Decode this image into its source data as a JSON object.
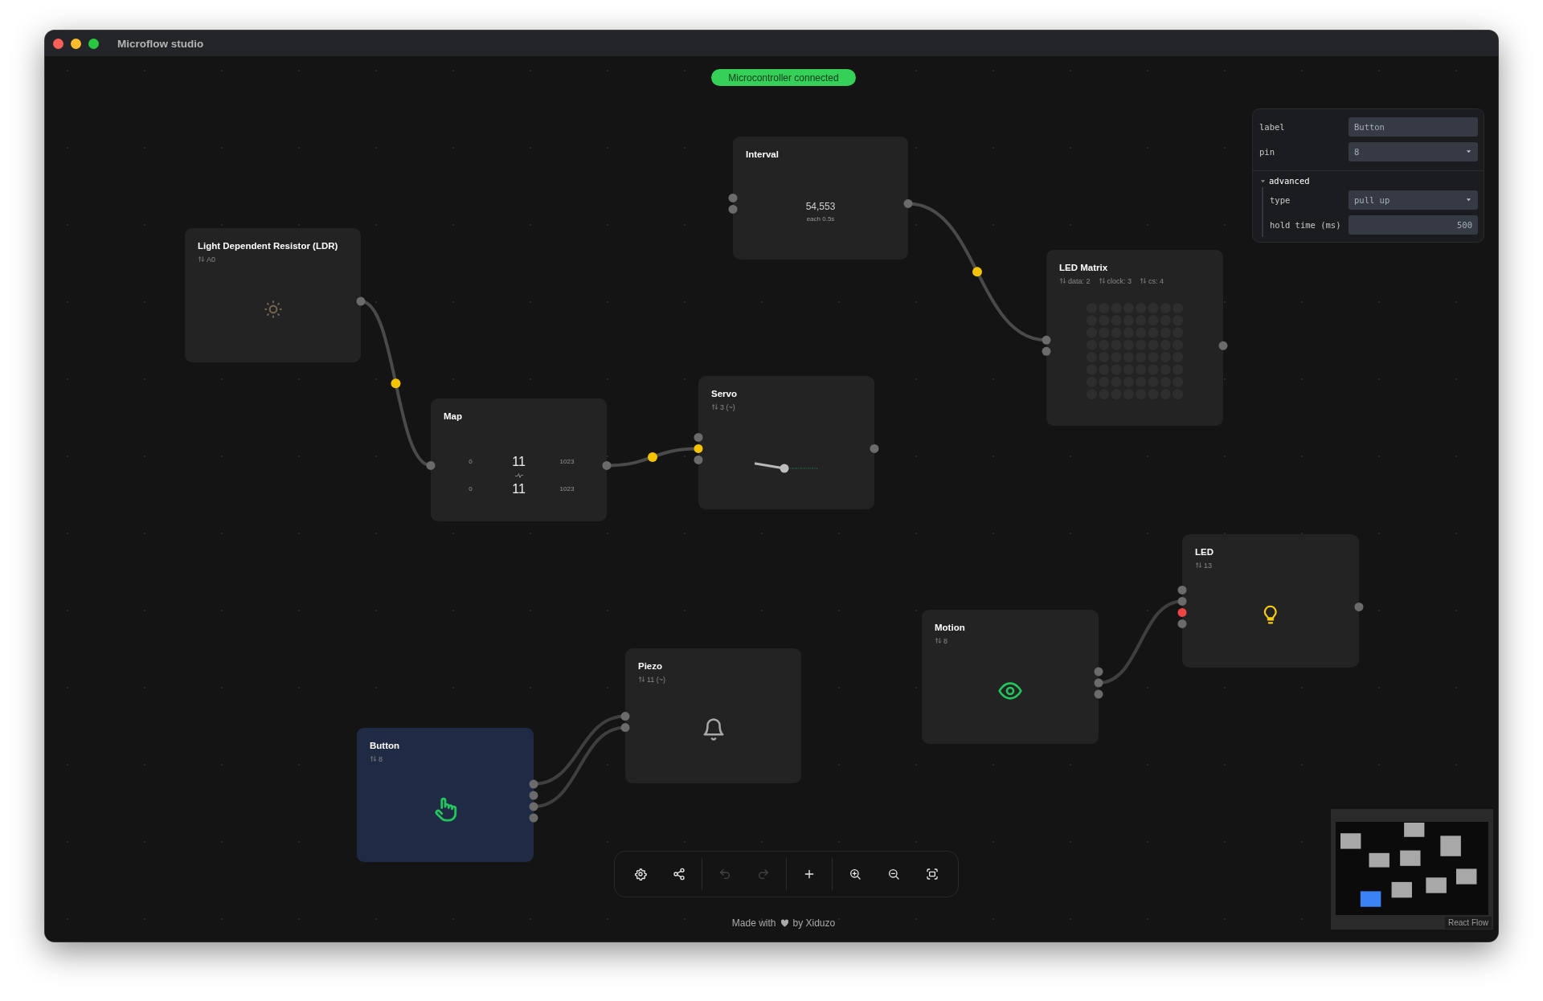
{
  "window": {
    "title": "Microflow studio"
  },
  "status_badge": {
    "text": "Microcontroller connected",
    "connected": true
  },
  "nodes": [
    {
      "kind": "ldr",
      "title": "Light Dependent Resistor (LDR)",
      "pins": [
        "A0"
      ],
      "selected": false,
      "outputs": [
        {
          "color": "#6b6b6b"
        }
      ]
    },
    {
      "kind": "interval",
      "title": "Interval",
      "value": "54,553",
      "caption": "each 0.5s",
      "selected": false,
      "inputs": [
        {
          "color": "#6b6b6b"
        },
        {
          "color": "#6b6b6b"
        }
      ],
      "outputs": [
        {
          "color": "#6b6b6b"
        }
      ]
    },
    {
      "kind": "matrix",
      "title": "LED Matrix",
      "pins": [
        "data: 2",
        "clock: 3",
        "cs: 4"
      ],
      "selected": false,
      "inputs": [
        {
          "color": "#6b6b6b"
        },
        {
          "color": "#6b6b6b"
        }
      ],
      "outputs": [
        {
          "color": "#6b6b6b"
        }
      ]
    },
    {
      "kind": "map",
      "title": "Map",
      "rows": [
        [
          "0",
          "11",
          "1023"
        ],
        [
          "0",
          "11",
          "1023"
        ]
      ],
      "selected": false,
      "inputs": [
        {
          "color": "#6b6b6b"
        }
      ],
      "outputs": [
        {
          "color": "#6b6b6b"
        }
      ]
    },
    {
      "kind": "servo",
      "title": "Servo",
      "pins": [
        "3 (~)"
      ],
      "selected": false,
      "inputs": [
        {
          "color": "#6b6b6b"
        },
        {
          "color": "#f5c400"
        },
        {
          "color": "#6b6b6b"
        }
      ],
      "outputs": [
        {
          "color": "#6b6b6b"
        }
      ]
    },
    {
      "kind": "led",
      "title": "LED",
      "pins": [
        "13"
      ],
      "on": true,
      "selected": false,
      "inputs": [
        {
          "color": "#6b6b6b"
        },
        {
          "color": "#6b6b6b"
        },
        {
          "color": "#ef4444"
        },
        {
          "color": "#6b6b6b"
        }
      ],
      "outputs": [
        {
          "color": "#6b6b6b"
        }
      ]
    },
    {
      "kind": "motion",
      "title": "Motion",
      "pins": [
        "8"
      ],
      "selected": false,
      "outputs": [
        {
          "color": "#6b6b6b"
        },
        {
          "color": "#6b6b6b"
        },
        {
          "color": "#6b6b6b"
        }
      ]
    },
    {
      "kind": "piezo",
      "title": "Piezo",
      "pins": [
        "11 (~)"
      ],
      "selected": false,
      "inputs": [
        {
          "color": "#6b6b6b"
        },
        {
          "color": "#6b6b6b"
        }
      ]
    },
    {
      "kind": "button",
      "title": "Button",
      "pins": [
        "8"
      ],
      "selected": true,
      "outputs": [
        {
          "color": "#6b6b6b"
        },
        {
          "color": "#6b6b6b"
        },
        {
          "color": "#6b6b6b"
        },
        {
          "color": "#6b6b6b"
        }
      ]
    }
  ],
  "edges": [
    {
      "active": true
    },
    {
      "active": true
    },
    {
      "active": true
    },
    {
      "active": false
    },
    {
      "active": false
    },
    {
      "active": false
    }
  ],
  "inspector": {
    "fields": [
      {
        "label": "label",
        "kind": "text",
        "value": "Button"
      },
      {
        "label": "pin",
        "kind": "select",
        "value": "8"
      }
    ],
    "section": {
      "title": "advanced",
      "expanded": true,
      "fields": [
        {
          "label": "type",
          "kind": "select",
          "value": "pull up"
        },
        {
          "label": "hold time (ms)",
          "kind": "number",
          "value": "500"
        }
      ]
    }
  },
  "toolbar": [
    {
      "kind": "settings",
      "disabled": false
    },
    {
      "kind": "share",
      "disabled": false
    },
    {
      "kind": "divider"
    },
    {
      "kind": "undo",
      "disabled": true
    },
    {
      "kind": "redo",
      "disabled": true
    },
    {
      "kind": "divider"
    },
    {
      "kind": "add",
      "disabled": false
    },
    {
      "kind": "divider"
    },
    {
      "kind": "zoom_in",
      "disabled": false
    },
    {
      "kind": "zoom_out",
      "disabled": false
    },
    {
      "kind": "fit",
      "disabled": false
    }
  ],
  "footer": {
    "before": "Made with",
    "after": "by Xiduzo"
  },
  "minimap": {
    "attribution": "React Flow"
  }
}
